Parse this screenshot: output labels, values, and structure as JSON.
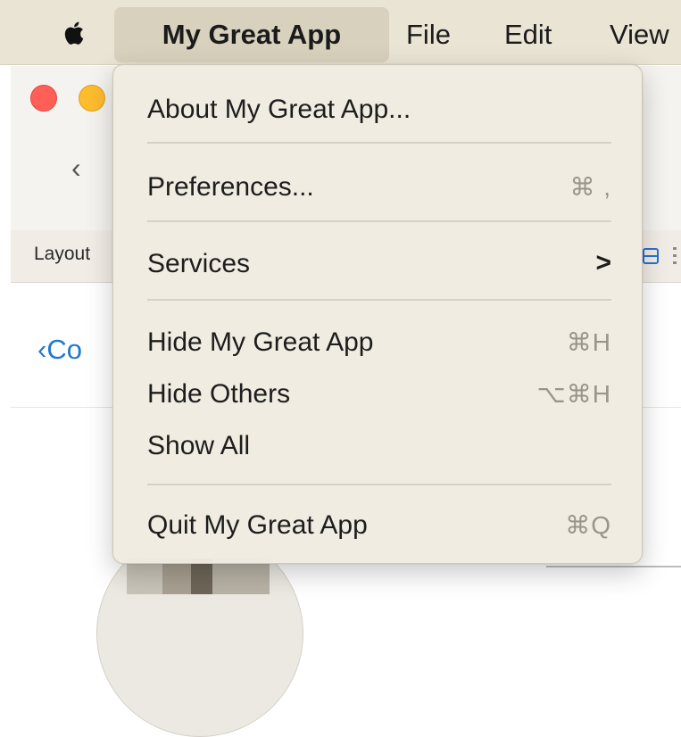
{
  "menubar": {
    "apple_icon": "apple-logo-icon",
    "app_menu": "My Great App",
    "file": "File",
    "edit": "Edit",
    "view": "View"
  },
  "window": {
    "back_chevron": "‹",
    "layout_label": "Layout",
    "back_link": "‹Co"
  },
  "menu": {
    "items": [
      {
        "label": "About My Great App...",
        "shortcut": ""
      },
      {
        "label": "Preferences...",
        "shortcut": "⌘ ,"
      },
      {
        "label": "Services",
        "submenu_indicator": ">"
      },
      {
        "label": "Hide My Great App",
        "shortcut": "⌘H"
      },
      {
        "label": "Hide Others",
        "shortcut": "⌥⌘H"
      },
      {
        "label": "Show All",
        "shortcut": ""
      },
      {
        "label": "Quit My Great App",
        "shortcut": "⌘Q"
      }
    ]
  },
  "colors": {
    "menubar_bg": "#eae4d4",
    "menu_bg": "#f0ebe1",
    "accent": "#1f78d1",
    "traffic_close": "#ff5f57",
    "traffic_minimize": "#febc2e"
  }
}
